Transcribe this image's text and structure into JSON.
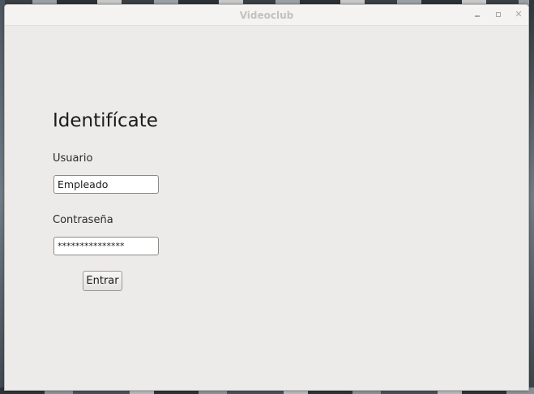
{
  "window": {
    "title": "Videoclub",
    "controls": {
      "minimize": "minimize-icon",
      "maximize": "maximize-icon",
      "close": "close-icon"
    }
  },
  "login": {
    "heading": "Identifícate",
    "user_label": "Usuario",
    "user_value": "Empleado",
    "password_label": "Contraseña",
    "password_value": "***************",
    "submit_label": "Entrar"
  }
}
